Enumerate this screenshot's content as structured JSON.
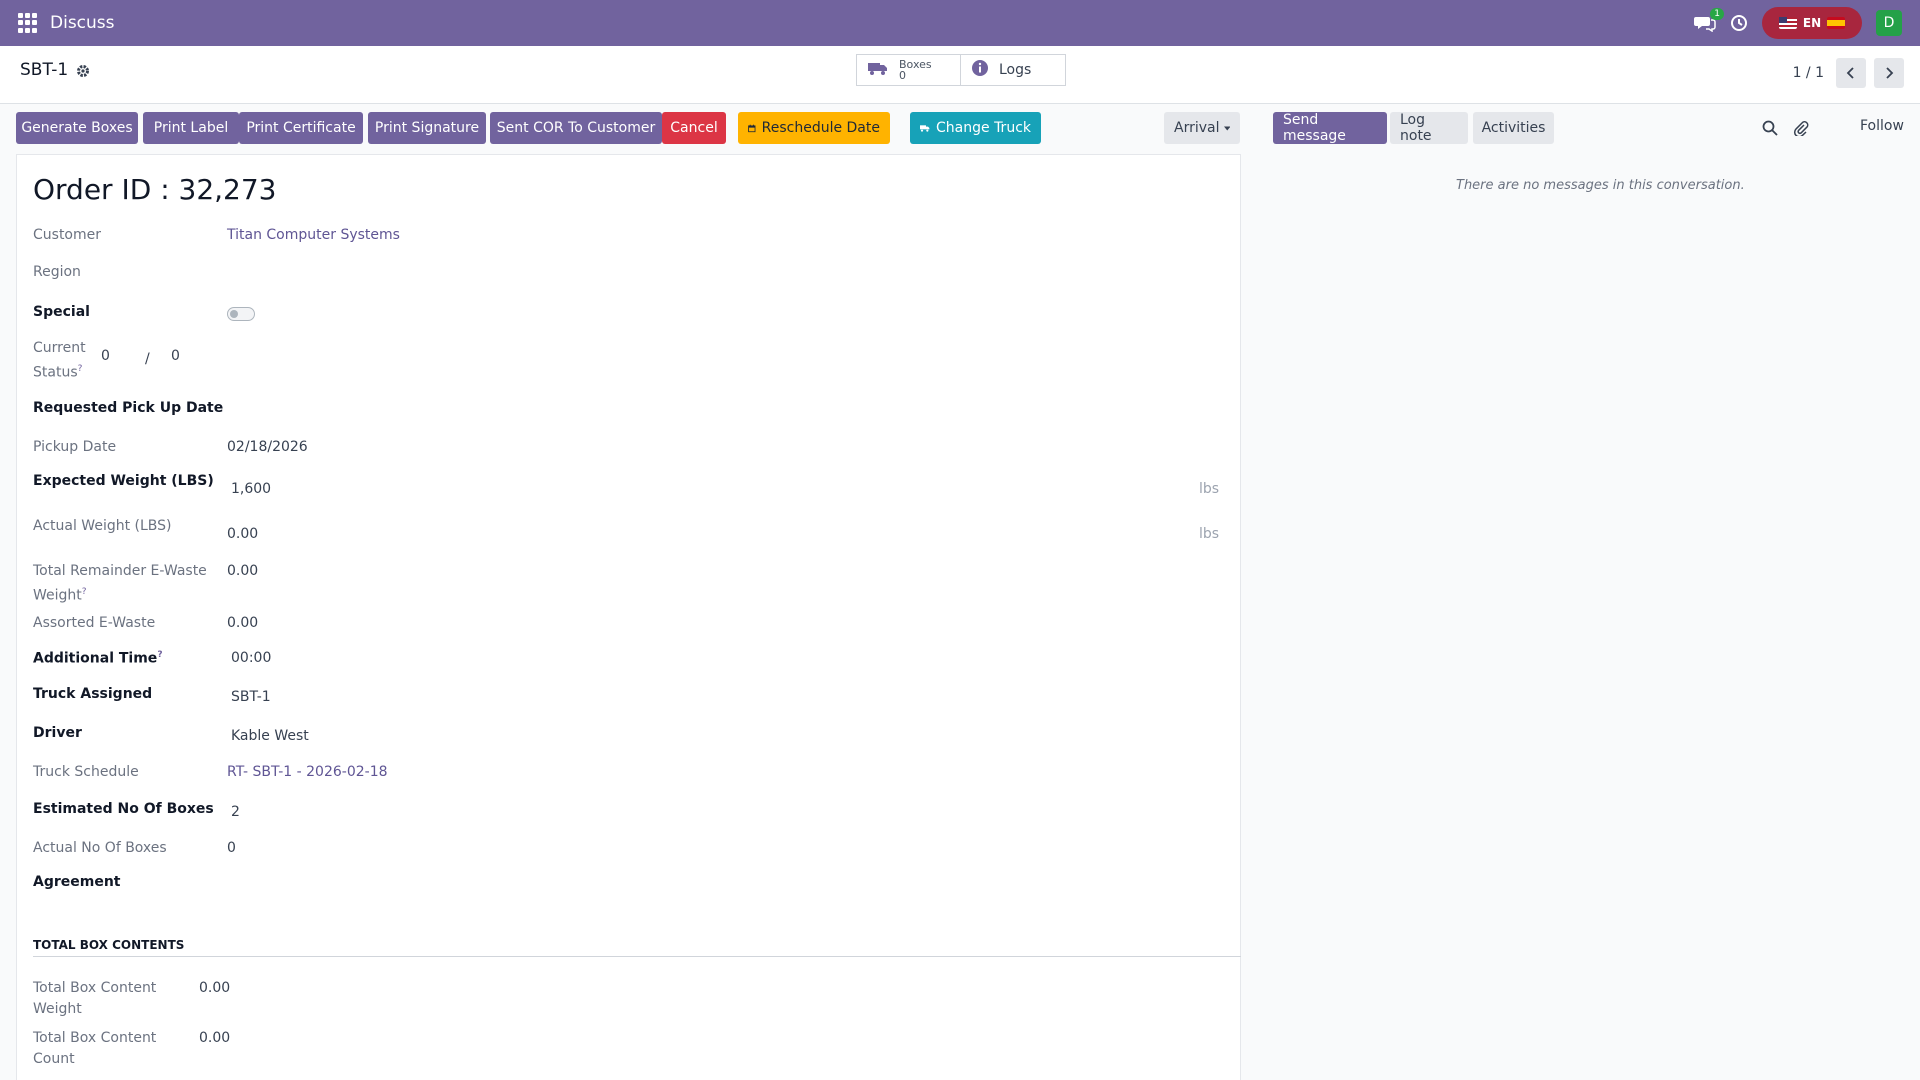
{
  "navbar": {
    "app_title": "Discuss",
    "chat_badge": "1",
    "lang_code": "EN",
    "avatar_letter": "D",
    "brand_color": "#71639e"
  },
  "control": {
    "record_title": "SBT-1",
    "smart_buttons": {
      "boxes_label": "Boxes",
      "boxes_count": "0",
      "logs_label": "Logs"
    },
    "pager": "1 / 1"
  },
  "actions": {
    "generate_boxes": "Generate Boxes",
    "print_label": "Print Label",
    "print_certificate": "Print Certificate",
    "print_signature": "Print Signature",
    "sent_cor": "Sent COR To Customer",
    "cancel": "Cancel",
    "reschedule_date": "Reschedule Date",
    "change_truck": "Change Truck",
    "status_dropdown": "Arrival"
  },
  "form": {
    "order_title": "Order ID : 32,273",
    "fields": {
      "customer_label": "Customer",
      "customer_value": "Titan Computer Systems",
      "region_label": "Region",
      "special_label": "Special",
      "current_label": "Current",
      "status_label": "Status",
      "current_status_a": "0",
      "current_status_sep": "/",
      "current_status_b": "0",
      "requested_pickup_label": "Requested Pick Up Date",
      "pickup_date_label": "Pickup Date",
      "pickup_date_value": "02/18/2026",
      "expected_weight_label": "Expected Weight (LBS)",
      "expected_weight_value": "1,600",
      "actual_weight_label": "Actual Weight (LBS)",
      "actual_weight_value": "0.00",
      "unit_lbs": "lbs",
      "total_remainder_label_1": "Total Remainder E-Waste",
      "total_remainder_label_2": "Weight",
      "total_remainder_value": "0.00",
      "assorted_label": "Assorted E-Waste",
      "assorted_value": "0.00",
      "additional_time_label": "Additional Time",
      "additional_time_value": "00:00",
      "truck_assigned_label": "Truck Assigned",
      "truck_assigned_value": "SBT-1",
      "driver_label": "Driver",
      "driver_value": "Kable West",
      "truck_schedule_label": "Truck Schedule",
      "truck_schedule_value": "RT- SBT-1 - 2026-02-18",
      "estimated_boxes_label": "Estimated No Of Boxes",
      "estimated_boxes_value": "2",
      "actual_boxes_label": "Actual No Of Boxes",
      "actual_boxes_value": "0",
      "agreement_label": "Agreement"
    },
    "box_contents": {
      "section_title": "TOTAL BOX CONTENTS",
      "weight_label_1": "Total Box Content",
      "weight_label_2": "Weight",
      "weight_value": "0.00",
      "count_label_1": "Total Box Content",
      "count_label_2": "Count",
      "count_value": "0.00"
    }
  },
  "chatter": {
    "send_message": "Send message",
    "log_note": "Log note",
    "activities": "Activities",
    "follow": "Follow",
    "empty_text": "There are no messages in this conversation."
  }
}
